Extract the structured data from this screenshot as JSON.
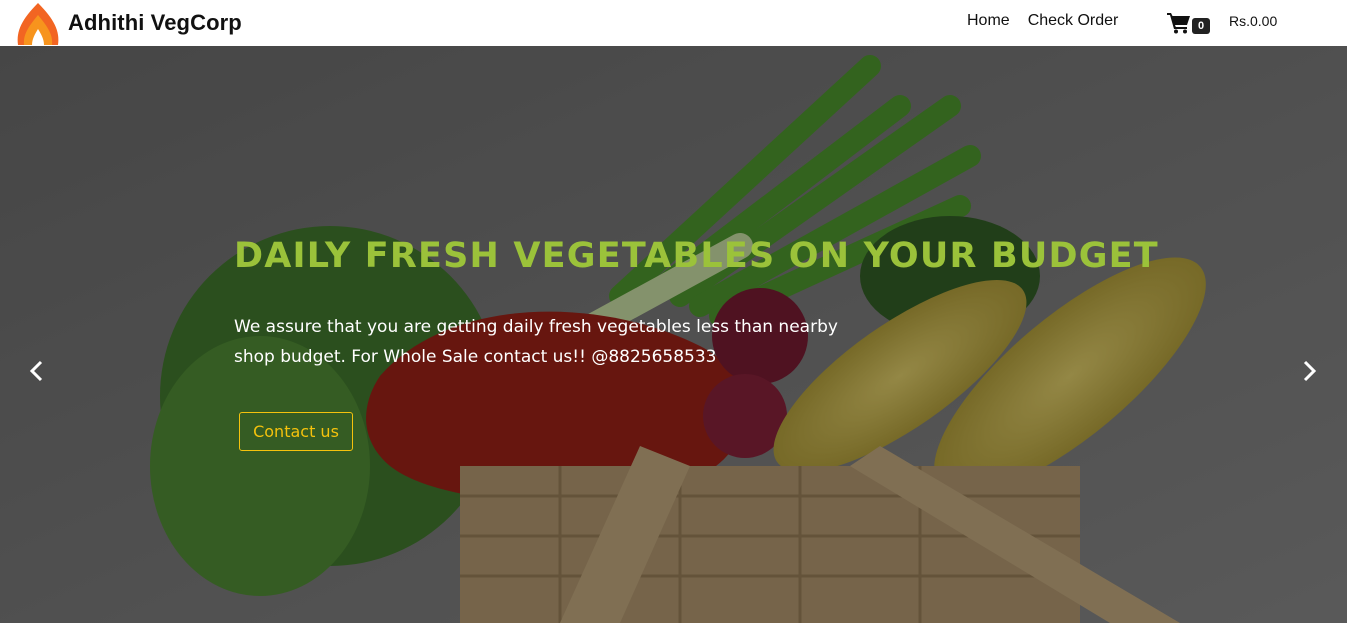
{
  "header": {
    "brand_name": "Adhithi VegCorp",
    "logo_icon": "flame-logo-icon",
    "nav": [
      {
        "label": "Home"
      },
      {
        "label": "Check Order"
      }
    ],
    "cart": {
      "icon": "shopping-cart-icon",
      "count": "0"
    },
    "total": "Rs.0.00"
  },
  "hero": {
    "title": "DAILY FRESH VEGETABLES ON YOUR BUDGET",
    "description": "We assure that you are getting daily fresh vegetables less than nearby shop budget. For Whole Sale contact us!! @8825658533",
    "button_label": "Contact us",
    "prev_icon": "chevron-left-icon",
    "next_icon": "chevron-right-icon"
  },
  "colors": {
    "title_green": "#9bc23a",
    "button_yellow": "#f4c20d",
    "logo_orange": "#f26522"
  }
}
